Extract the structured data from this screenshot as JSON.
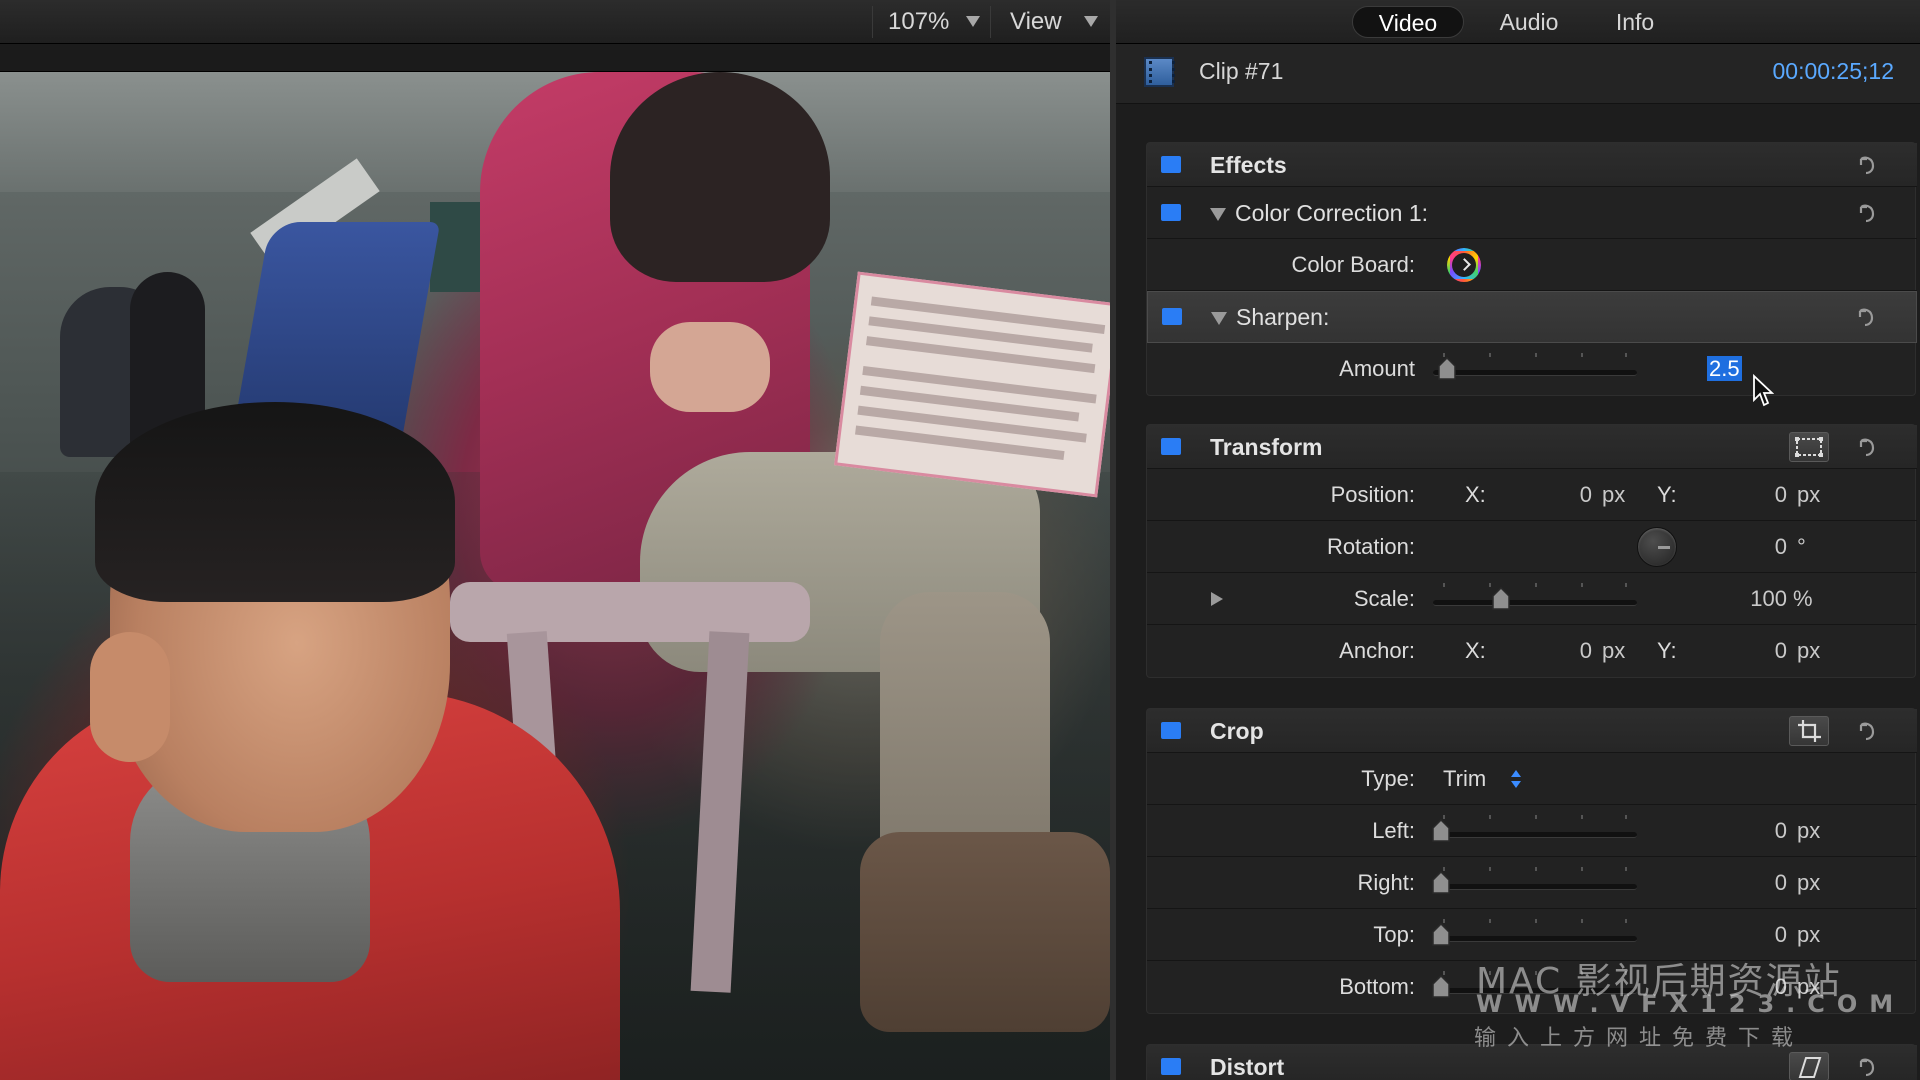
{
  "viewer": {
    "zoom": "107%",
    "view_label": "View"
  },
  "inspector": {
    "tabs": [
      {
        "label": "Video",
        "active": true
      },
      {
        "label": "Audio",
        "active": false
      },
      {
        "label": "Info",
        "active": false
      }
    ],
    "clip": {
      "name": "Clip #71",
      "timecode": "00:00:25;12"
    },
    "effects": {
      "title": "Effects",
      "color_correction": {
        "title": "Color Correction 1:",
        "color_board_label": "Color Board:"
      },
      "sharpen": {
        "title": "Sharpen:",
        "amount_label": "Amount",
        "amount_value": "2.5"
      }
    },
    "transform": {
      "title": "Transform",
      "position_label": "Position:",
      "position_x_label": "X:",
      "position_x": "0",
      "position_y_label": "Y:",
      "position_y": "0",
      "px_unit": "px",
      "rotation_label": "Rotation:",
      "rotation_value": "0",
      "rotation_unit": "°",
      "scale_label": "Scale:",
      "scale_value": "100",
      "scale_unit": "%",
      "anchor_label": "Anchor:",
      "anchor_x_label": "X:",
      "anchor_x": "0",
      "anchor_y_label": "Y:",
      "anchor_y": "0"
    },
    "crop": {
      "title": "Crop",
      "type_label": "Type:",
      "type_value": "Trim",
      "left_label": "Left:",
      "left_value": "0",
      "right_label": "Right:",
      "right_value": "0",
      "top_label": "Top:",
      "top_value": "0",
      "bottom_label": "Bottom:",
      "bottom_value": "0",
      "px_unit": "px"
    },
    "distort": {
      "title": "Distort"
    }
  },
  "watermark": {
    "line1": "MAC 影视后期资源站",
    "line2": "WWW.VFX123.COM",
    "line3": "输 入 上 方 网 址 免 费 下 载"
  },
  "colors": {
    "accent_blue": "#2a7df5",
    "timecode_blue": "#5aa9ff",
    "panel_bg": "#1d1d1d"
  }
}
